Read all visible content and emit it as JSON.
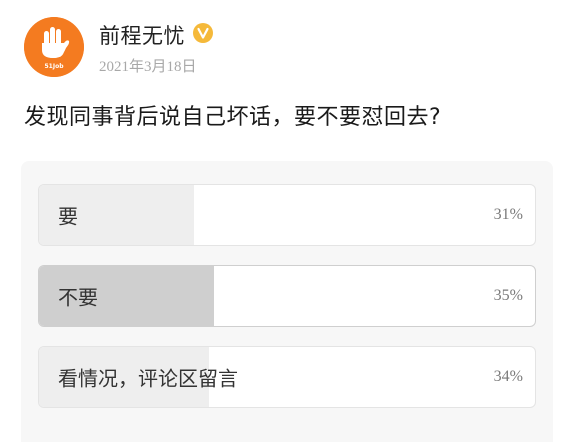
{
  "author": {
    "name": "前程无忧",
    "avatar_icon": "hand-logo-icon",
    "avatar_caption": "51Job",
    "verified_icon": "verified-badge-icon",
    "brand_color": "#f47b20",
    "badge_color": "#f5b93a"
  },
  "post": {
    "date": "2021年3月18日",
    "text": "发现同事背后说自己坏话，要不要怼回去?"
  },
  "poll": {
    "options": [
      {
        "label": "要",
        "percent_label": "31%",
        "percent": 31,
        "selected": false
      },
      {
        "label": "不要",
        "percent_label": "35%",
        "percent": 35,
        "selected": true
      },
      {
        "label": "看情况，评论区留言",
        "percent_label": "34%",
        "percent": 34,
        "selected": false
      }
    ]
  }
}
